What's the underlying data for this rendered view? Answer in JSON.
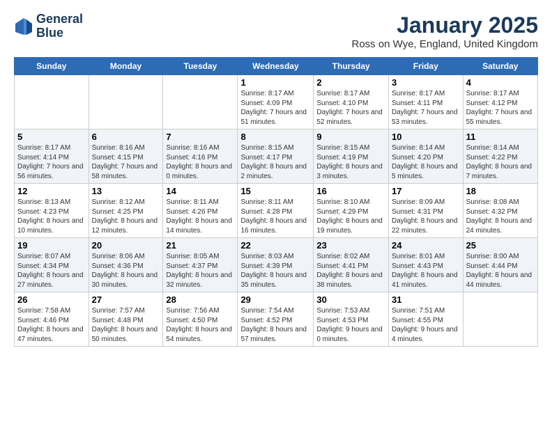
{
  "header": {
    "logo_line1": "General",
    "logo_line2": "Blue",
    "month": "January 2025",
    "location": "Ross on Wye, England, United Kingdom"
  },
  "days_of_week": [
    "Sunday",
    "Monday",
    "Tuesday",
    "Wednesday",
    "Thursday",
    "Friday",
    "Saturday"
  ],
  "weeks": [
    [
      {
        "day": "",
        "text": ""
      },
      {
        "day": "",
        "text": ""
      },
      {
        "day": "",
        "text": ""
      },
      {
        "day": "1",
        "text": "Sunrise: 8:17 AM\nSunset: 4:09 PM\nDaylight: 7 hours and 51 minutes."
      },
      {
        "day": "2",
        "text": "Sunrise: 8:17 AM\nSunset: 4:10 PM\nDaylight: 7 hours and 52 minutes."
      },
      {
        "day": "3",
        "text": "Sunrise: 8:17 AM\nSunset: 4:11 PM\nDaylight: 7 hours and 53 minutes."
      },
      {
        "day": "4",
        "text": "Sunrise: 8:17 AM\nSunset: 4:12 PM\nDaylight: 7 hours and 55 minutes."
      }
    ],
    [
      {
        "day": "5",
        "text": "Sunrise: 8:17 AM\nSunset: 4:14 PM\nDaylight: 7 hours and 56 minutes."
      },
      {
        "day": "6",
        "text": "Sunrise: 8:16 AM\nSunset: 4:15 PM\nDaylight: 7 hours and 58 minutes."
      },
      {
        "day": "7",
        "text": "Sunrise: 8:16 AM\nSunset: 4:16 PM\nDaylight: 8 hours and 0 minutes."
      },
      {
        "day": "8",
        "text": "Sunrise: 8:15 AM\nSunset: 4:17 PM\nDaylight: 8 hours and 2 minutes."
      },
      {
        "day": "9",
        "text": "Sunrise: 8:15 AM\nSunset: 4:19 PM\nDaylight: 8 hours and 3 minutes."
      },
      {
        "day": "10",
        "text": "Sunrise: 8:14 AM\nSunset: 4:20 PM\nDaylight: 8 hours and 5 minutes."
      },
      {
        "day": "11",
        "text": "Sunrise: 8:14 AM\nSunset: 4:22 PM\nDaylight: 8 hours and 7 minutes."
      }
    ],
    [
      {
        "day": "12",
        "text": "Sunrise: 8:13 AM\nSunset: 4:23 PM\nDaylight: 8 hours and 10 minutes."
      },
      {
        "day": "13",
        "text": "Sunrise: 8:12 AM\nSunset: 4:25 PM\nDaylight: 8 hours and 12 minutes."
      },
      {
        "day": "14",
        "text": "Sunrise: 8:11 AM\nSunset: 4:26 PM\nDaylight: 8 hours and 14 minutes."
      },
      {
        "day": "15",
        "text": "Sunrise: 8:11 AM\nSunset: 4:28 PM\nDaylight: 8 hours and 16 minutes."
      },
      {
        "day": "16",
        "text": "Sunrise: 8:10 AM\nSunset: 4:29 PM\nDaylight: 8 hours and 19 minutes."
      },
      {
        "day": "17",
        "text": "Sunrise: 8:09 AM\nSunset: 4:31 PM\nDaylight: 8 hours and 22 minutes."
      },
      {
        "day": "18",
        "text": "Sunrise: 8:08 AM\nSunset: 4:32 PM\nDaylight: 8 hours and 24 minutes."
      }
    ],
    [
      {
        "day": "19",
        "text": "Sunrise: 8:07 AM\nSunset: 4:34 PM\nDaylight: 8 hours and 27 minutes."
      },
      {
        "day": "20",
        "text": "Sunrise: 8:06 AM\nSunset: 4:36 PM\nDaylight: 8 hours and 30 minutes."
      },
      {
        "day": "21",
        "text": "Sunrise: 8:05 AM\nSunset: 4:37 PM\nDaylight: 8 hours and 32 minutes."
      },
      {
        "day": "22",
        "text": "Sunrise: 8:03 AM\nSunset: 4:39 PM\nDaylight: 8 hours and 35 minutes."
      },
      {
        "day": "23",
        "text": "Sunrise: 8:02 AM\nSunset: 4:41 PM\nDaylight: 8 hours and 38 minutes."
      },
      {
        "day": "24",
        "text": "Sunrise: 8:01 AM\nSunset: 4:43 PM\nDaylight: 8 hours and 41 minutes."
      },
      {
        "day": "25",
        "text": "Sunrise: 8:00 AM\nSunset: 4:44 PM\nDaylight: 8 hours and 44 minutes."
      }
    ],
    [
      {
        "day": "26",
        "text": "Sunrise: 7:58 AM\nSunset: 4:46 PM\nDaylight: 8 hours and 47 minutes."
      },
      {
        "day": "27",
        "text": "Sunrise: 7:57 AM\nSunset: 4:48 PM\nDaylight: 8 hours and 50 minutes."
      },
      {
        "day": "28",
        "text": "Sunrise: 7:56 AM\nSunset: 4:50 PM\nDaylight: 8 hours and 54 minutes."
      },
      {
        "day": "29",
        "text": "Sunrise: 7:54 AM\nSunset: 4:52 PM\nDaylight: 8 hours and 57 minutes."
      },
      {
        "day": "30",
        "text": "Sunrise: 7:53 AM\nSunset: 4:53 PM\nDaylight: 9 hours and 0 minutes."
      },
      {
        "day": "31",
        "text": "Sunrise: 7:51 AM\nSunset: 4:55 PM\nDaylight: 9 hours and 4 minutes."
      },
      {
        "day": "",
        "text": ""
      }
    ]
  ]
}
